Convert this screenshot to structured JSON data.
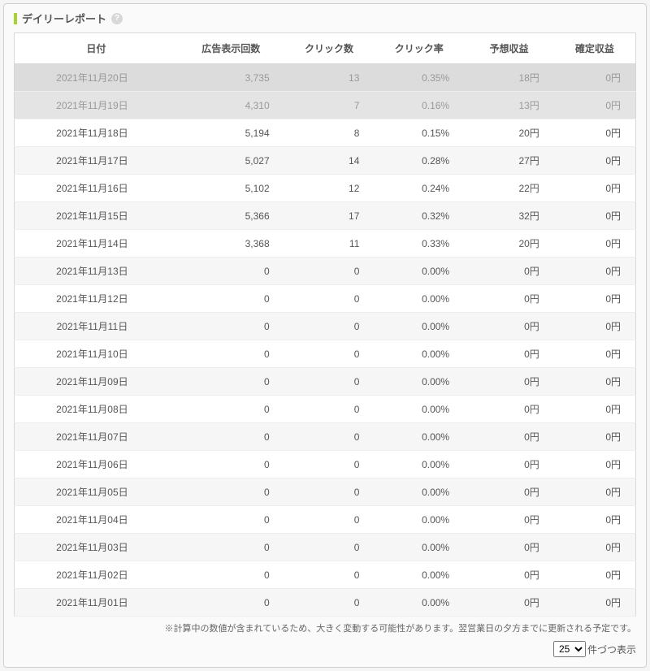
{
  "panel": {
    "title": "デイリーレポート",
    "help_icon": "?"
  },
  "table": {
    "headers": [
      "日付",
      "広告表示回数",
      "クリック数",
      "クリック率",
      "予想収益",
      "確定収益"
    ],
    "rows": [
      {
        "pending": true,
        "date": "2021年11月20日",
        "impressions": "3,735",
        "clicks": "13",
        "ctr": "0.35%",
        "est": "18円",
        "fixed": "0円"
      },
      {
        "pending": true,
        "date": "2021年11月19日",
        "impressions": "4,310",
        "clicks": "7",
        "ctr": "0.16%",
        "est": "13円",
        "fixed": "0円"
      },
      {
        "pending": false,
        "date": "2021年11月18日",
        "impressions": "5,194",
        "clicks": "8",
        "ctr": "0.15%",
        "est": "20円",
        "fixed": "0円"
      },
      {
        "pending": false,
        "date": "2021年11月17日",
        "impressions": "5,027",
        "clicks": "14",
        "ctr": "0.28%",
        "est": "27円",
        "fixed": "0円"
      },
      {
        "pending": false,
        "date": "2021年11月16日",
        "impressions": "5,102",
        "clicks": "12",
        "ctr": "0.24%",
        "est": "22円",
        "fixed": "0円"
      },
      {
        "pending": false,
        "date": "2021年11月15日",
        "impressions": "5,366",
        "clicks": "17",
        "ctr": "0.32%",
        "est": "32円",
        "fixed": "0円"
      },
      {
        "pending": false,
        "date": "2021年11月14日",
        "impressions": "3,368",
        "clicks": "11",
        "ctr": "0.33%",
        "est": "20円",
        "fixed": "0円"
      },
      {
        "pending": false,
        "date": "2021年11月13日",
        "impressions": "0",
        "clicks": "0",
        "ctr": "0.00%",
        "est": "0円",
        "fixed": "0円"
      },
      {
        "pending": false,
        "date": "2021年11月12日",
        "impressions": "0",
        "clicks": "0",
        "ctr": "0.00%",
        "est": "0円",
        "fixed": "0円"
      },
      {
        "pending": false,
        "date": "2021年11月11日",
        "impressions": "0",
        "clicks": "0",
        "ctr": "0.00%",
        "est": "0円",
        "fixed": "0円"
      },
      {
        "pending": false,
        "date": "2021年11月10日",
        "impressions": "0",
        "clicks": "0",
        "ctr": "0.00%",
        "est": "0円",
        "fixed": "0円"
      },
      {
        "pending": false,
        "date": "2021年11月09日",
        "impressions": "0",
        "clicks": "0",
        "ctr": "0.00%",
        "est": "0円",
        "fixed": "0円"
      },
      {
        "pending": false,
        "date": "2021年11月08日",
        "impressions": "0",
        "clicks": "0",
        "ctr": "0.00%",
        "est": "0円",
        "fixed": "0円"
      },
      {
        "pending": false,
        "date": "2021年11月07日",
        "impressions": "0",
        "clicks": "0",
        "ctr": "0.00%",
        "est": "0円",
        "fixed": "0円"
      },
      {
        "pending": false,
        "date": "2021年11月06日",
        "impressions": "0",
        "clicks": "0",
        "ctr": "0.00%",
        "est": "0円",
        "fixed": "0円"
      },
      {
        "pending": false,
        "date": "2021年11月05日",
        "impressions": "0",
        "clicks": "0",
        "ctr": "0.00%",
        "est": "0円",
        "fixed": "0円"
      },
      {
        "pending": false,
        "date": "2021年11月04日",
        "impressions": "0",
        "clicks": "0",
        "ctr": "0.00%",
        "est": "0円",
        "fixed": "0円"
      },
      {
        "pending": false,
        "date": "2021年11月03日",
        "impressions": "0",
        "clicks": "0",
        "ctr": "0.00%",
        "est": "0円",
        "fixed": "0円"
      },
      {
        "pending": false,
        "date": "2021年11月02日",
        "impressions": "0",
        "clicks": "0",
        "ctr": "0.00%",
        "est": "0円",
        "fixed": "0円"
      },
      {
        "pending": false,
        "date": "2021年11月01日",
        "impressions": "0",
        "clicks": "0",
        "ctr": "0.00%",
        "est": "0円",
        "fixed": "0円"
      }
    ]
  },
  "footnote": "※計算中の数値が含まれているため、大きく変動する可能性があります。翌営業日の夕方までに更新される予定です。",
  "pager": {
    "selected": "25",
    "suffix": "件づつ表示"
  }
}
